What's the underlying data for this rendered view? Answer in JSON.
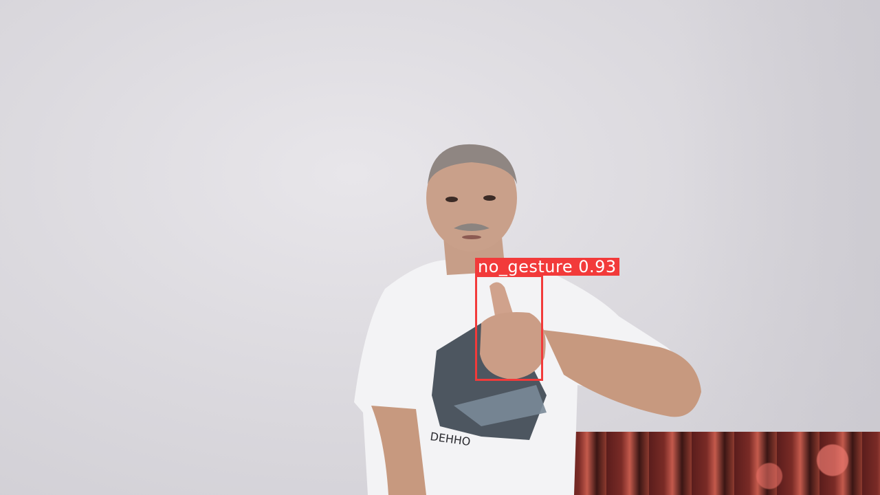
{
  "detection": {
    "label": "no_gesture",
    "confidence": "0.93",
    "color": "#f23a3a"
  },
  "scene": {
    "shirt_print_text": "DEHHO"
  }
}
